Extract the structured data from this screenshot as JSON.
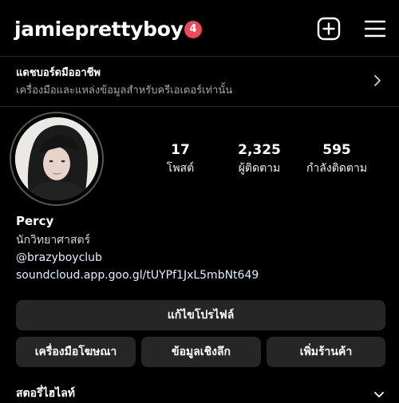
{
  "header": {
    "username": "jamieprettyboy",
    "notification_count": "4",
    "plus_icon": "plus-square-icon",
    "menu_icon": "hamburger-menu-icon"
  },
  "dashboard": {
    "title": "แดชบอร์ดมืออาชีพ",
    "subtitle": "เครื่องมือและแหล่งข้อมูลสำหรับครีเอเตอร์เท่านั้น",
    "chevron_icon": "chevron-right-icon"
  },
  "stats": {
    "posts": {
      "value": "17",
      "label": "โพสต์"
    },
    "followers": {
      "value": "2,325",
      "label": "ผู้ติดตาม"
    },
    "following": {
      "value": "595",
      "label": "กำลังติดตาม"
    }
  },
  "bio": {
    "name": "Percy",
    "category": "นักวิทยาศาสตร์",
    "mention": "@brazyboyclub",
    "link": "soundcloud.app.goo.gl/tUYPf1JxL5mbNt649"
  },
  "buttons": {
    "edit_profile": "แก้ไขโปรไฟล์",
    "ad_tools": "เครื่องมือโฆษณา",
    "insights": "ข้อมูลเชิงลึก",
    "add_shop": "เพิ่มร้านค้า"
  },
  "highlights": {
    "label": "สตอรี่ไฮไลท์",
    "chevron_icon": "chevron-down-icon"
  },
  "colors": {
    "background": "#000000",
    "badge": "#ed4956",
    "button": "#262626",
    "link": "#e0f1ff"
  }
}
